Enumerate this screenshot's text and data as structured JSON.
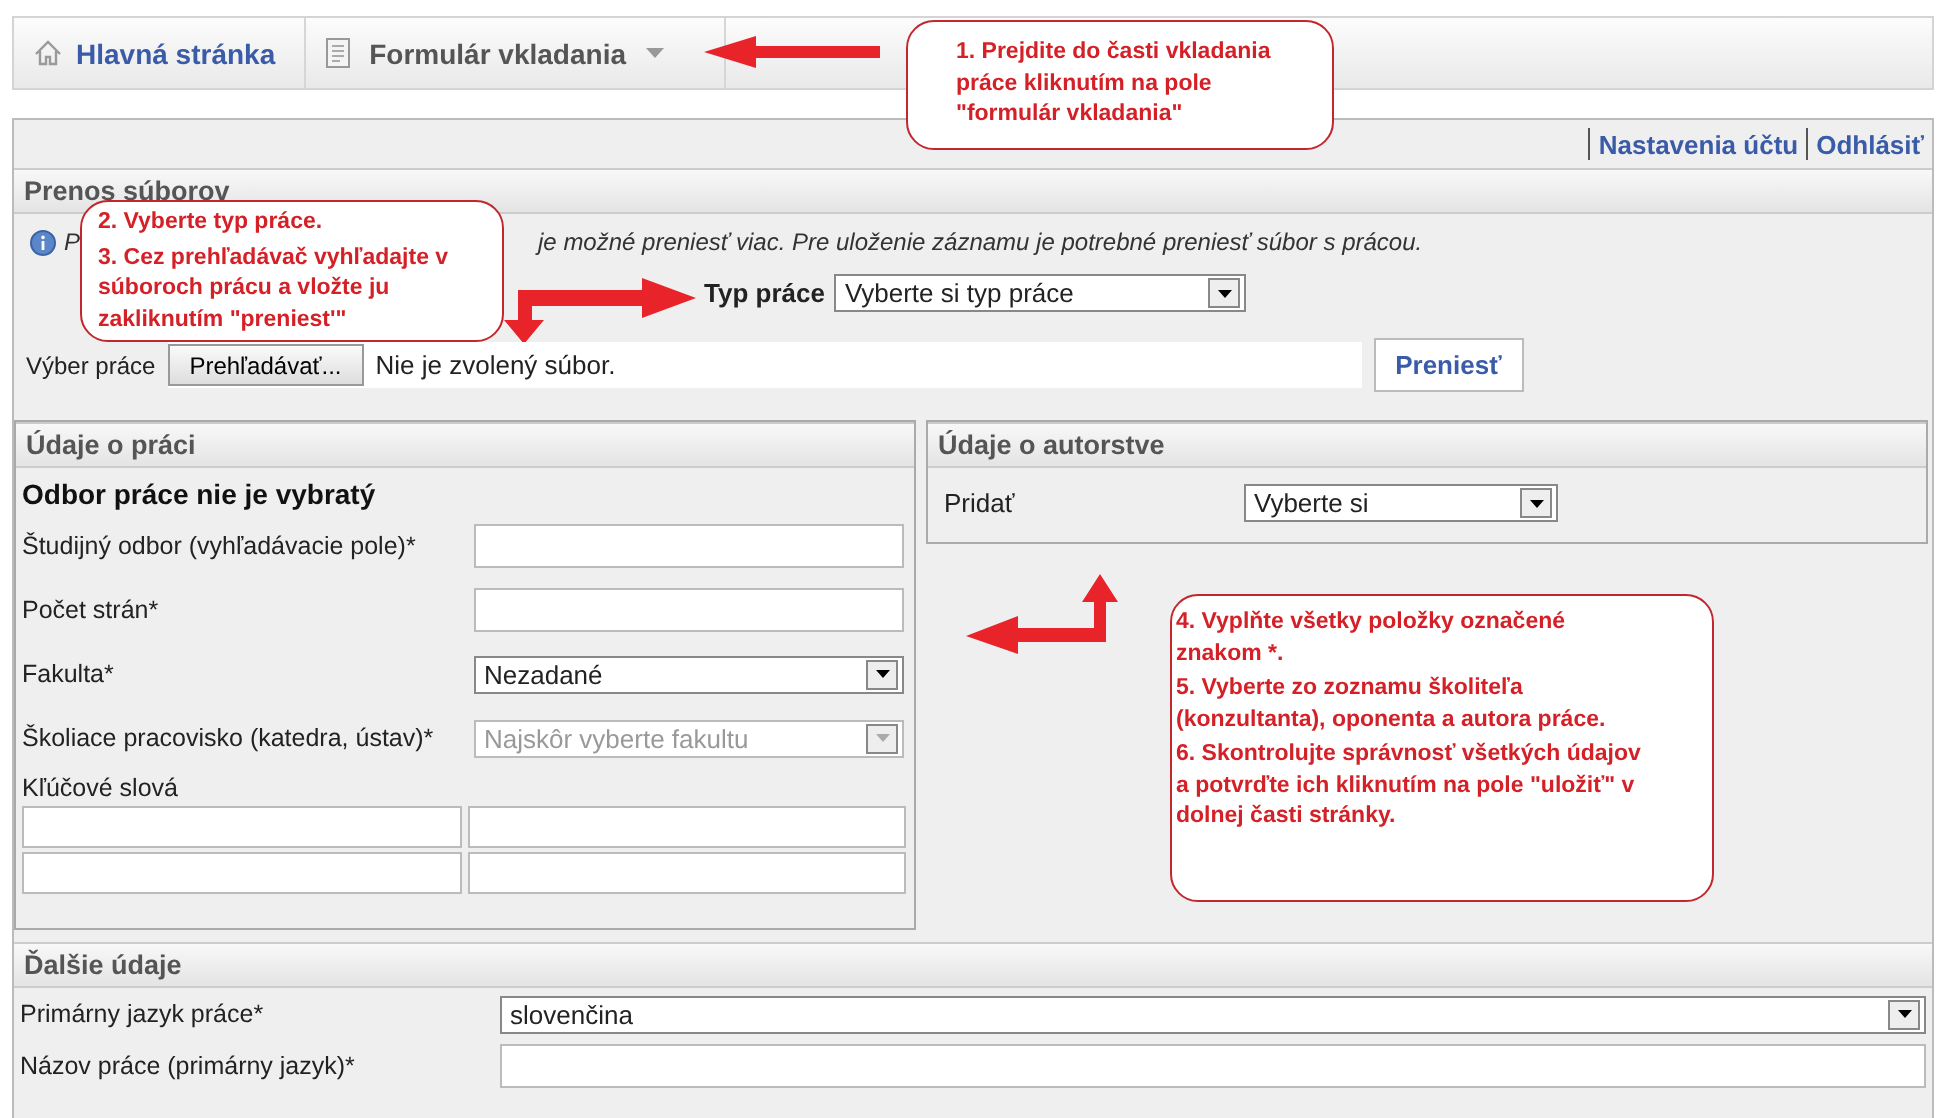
{
  "nav": {
    "items": [
      {
        "label": "Hlavná stránka",
        "kind": "home",
        "dropdown": false
      },
      {
        "label": "Formulár vkladania",
        "kind": "document",
        "dropdown": true
      }
    ]
  },
  "account_links": [
    "Nastavenia účtu",
    "Odhlásiť"
  ],
  "file_transfer": {
    "title": "Prenos súborov",
    "info_parts": [
      "P",
      "je možné preniesť viac. Pre uloženie záznamu je potrebné preniesť súbor s prácou."
    ],
    "type_label": "Typ práce",
    "type_select": "Vyberte si typ práce",
    "file_label": "Výber práce",
    "browse_button": "Prehľadávať...",
    "file_status": "Nie je zvolený súbor.",
    "upload_button": "Preniesť"
  },
  "work_details": {
    "title": "Údaje o práci",
    "subtitle": "Odbor práce nie je vybratý",
    "fields": [
      {
        "label": "Študijný odbor (vyhľadávacie pole)*",
        "kind": "text"
      },
      {
        "label": "Počet strán*",
        "kind": "text"
      },
      {
        "label": "Fakulta*",
        "kind": "select",
        "value": "Nezadané",
        "disabled": false
      },
      {
        "label": "Školiace pracovisko (katedra, ústav)*",
        "kind": "select",
        "value": "Najskôr vyberte fakultu",
        "disabled": true
      }
    ],
    "keywords_label": "Kľúčové slová"
  },
  "authorship": {
    "title": "Údaje o autorstve",
    "add_label": "Pridať",
    "add_select": "Vyberte si"
  },
  "other_details": {
    "title": "Ďalšie údaje",
    "fields": [
      {
        "label": "Primárny jazyk práce*",
        "kind": "select",
        "value": "slovenčina",
        "disabled": false
      },
      {
        "label": "Názov práce (primárny jazyk)*",
        "kind": "text"
      }
    ]
  },
  "callouts": [
    {
      "paragraphs": [
        "1. Prejdite do časti vkladania práce kliknutím na pole \"formulár vkladania\""
      ]
    },
    {
      "paragraphs": [
        "2. Vyberte typ práce.",
        "3. Cez prehľadávač vyhľadajte v súboroch prácu a vložte ju zakliknutím \"preniest'\""
      ]
    },
    {
      "paragraphs": [
        "4. Vyplňte všetky položky označené znakom   *.",
        "5. Vyberte zo zoznamu školiteľa (konzultanta), oponenta a autora práce.",
        "6. Skontrolujte správnosť všetkých údajov a potvrďte ich kliknutím na pole \"uložiť\" v dolnej časti stránky."
      ]
    }
  ]
}
